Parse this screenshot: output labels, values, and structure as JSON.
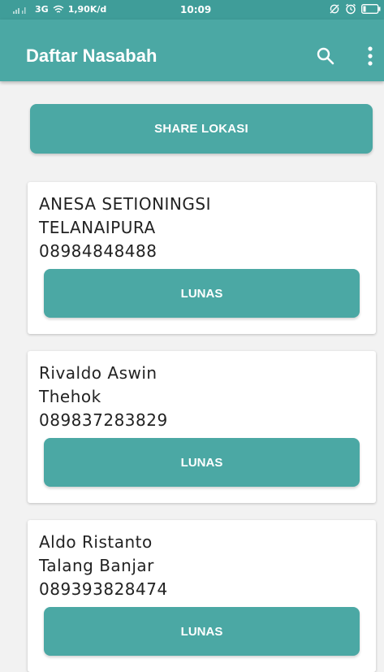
{
  "status_bar": {
    "network": "3G",
    "speed": "1,90K/d",
    "time": "10:09",
    "icons": [
      "signal-icon",
      "wifi-icon",
      "no-sync-icon",
      "alarm-icon",
      "battery-icon"
    ]
  },
  "app_bar": {
    "title": "Daftar Nasabah",
    "icons": [
      "search-icon",
      "more-vertical-icon"
    ]
  },
  "share_button_label": "SHARE LOKASI",
  "customers": [
    {
      "name": "ANESA SETIONINGSI",
      "location": "TELANAIPURA",
      "phone": "08984848488",
      "button_label": "LUNAS"
    },
    {
      "name": "Rivaldo Aswin",
      "location": "Thehok",
      "phone": "089837283829",
      "button_label": "LUNAS"
    },
    {
      "name": "Aldo Ristanto",
      "location": "Talang Banjar",
      "phone": "089393828474",
      "button_label": "LUNAS"
    }
  ],
  "colors": {
    "primary": "#4ba8a4",
    "status_bar": "#3f9d99",
    "background": "#f2f2f2",
    "card": "#ffffff"
  }
}
